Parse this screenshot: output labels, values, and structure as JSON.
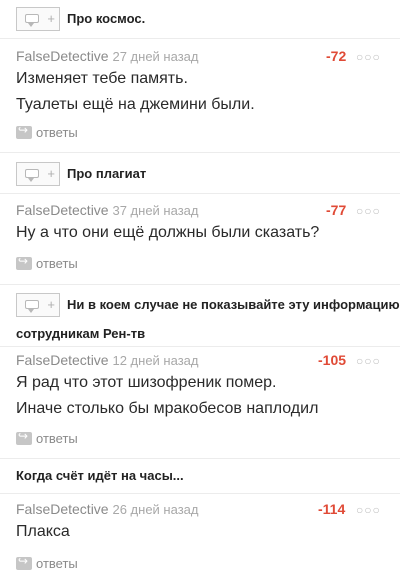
{
  "threads": [
    {
      "post_title": "Про космос.",
      "comment": {
        "author": "FalseDetective",
        "time": "27 дней назад",
        "score": "-72",
        "lines": [
          "Изменяет тебе память.",
          "Туалеты ещё на джемини были."
        ],
        "replies_label": "ответы"
      }
    },
    {
      "post_title": "Про плагиат",
      "comment": {
        "author": "FalseDetective",
        "time": "37 дней назад",
        "score": "-77",
        "lines": [
          "Ну а что они ещё должны были сказать?"
        ],
        "replies_label": "ответы"
      }
    },
    {
      "post_title_line1": "Ни в коем случае не показывайте эту информацию",
      "post_title_line2": "сотрудникам Рен-тв",
      "comment": {
        "author": "FalseDetective",
        "time": "12 дней назад",
        "score": "-105",
        "lines": [
          "Я рад что этот шизофреник помер.",
          "Иначе столько бы мракобесов наплодил"
        ],
        "replies_label": "ответы"
      }
    },
    {
      "post_title": "Когда счёт идёт на часы...",
      "comment": {
        "author": "FalseDetective",
        "time": "26 дней назад",
        "score": "-114",
        "lines": [
          "Плакса"
        ],
        "replies_label": "ответы"
      }
    }
  ],
  "more_glyph": "○○○",
  "plus_glyph": "+",
  "colors": {
    "score": "#e04a36",
    "author": "#8a8a8a"
  }
}
